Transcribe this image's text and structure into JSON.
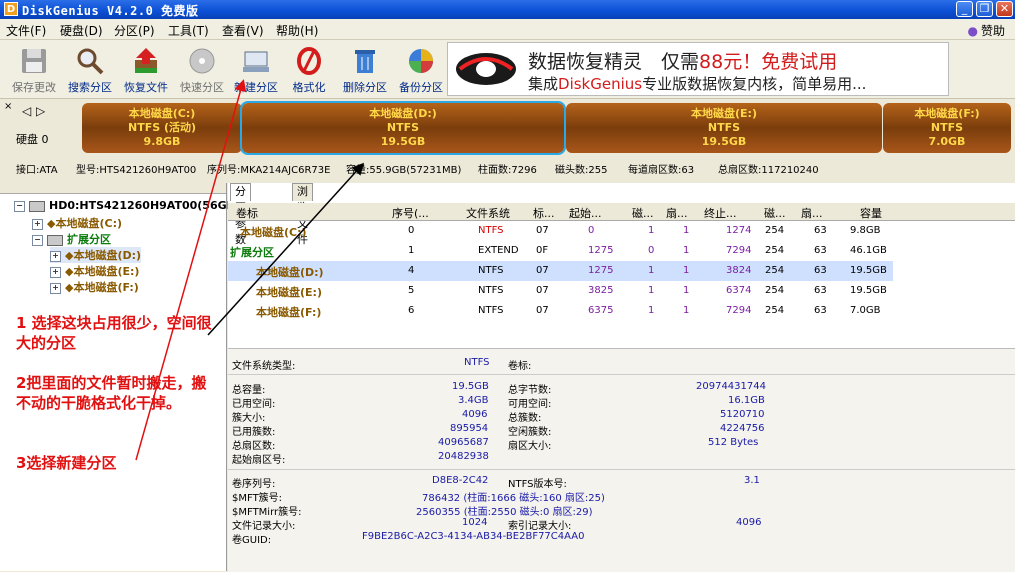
{
  "window": {
    "title": "DiskGenius V4.2.0 免费版",
    "app_icon": "D"
  },
  "menu": [
    "文件(F)",
    "硬盘(D)",
    "分区(P)",
    "工具(T)",
    "查看(V)",
    "帮助(H)"
  ],
  "sponsor": "赞助",
  "toolbar": [
    "保存更改",
    "搜索分区",
    "恢复文件",
    "快速分区",
    "新建分区",
    "格式化",
    "删除分区",
    "备份分区"
  ],
  "banner": {
    "line1_a": "数据恢复精灵",
    "line1_b": "仅需",
    "line1_price": "88元",
    "line1_c": "！免费试用",
    "line2_a": "集成",
    "line2_brand": "DiskGenius",
    "line2_b": "专业版数据恢复内核，简单易用..."
  },
  "disk": {
    "label": "硬盘 0",
    "partitions": [
      {
        "name": "本地磁盘(C:)",
        "fs": "NTFS (活动)",
        "size": "9.8GB"
      },
      {
        "name": "本地磁盘(D:)",
        "fs": "NTFS",
        "size": "19.5GB"
      },
      {
        "name": "本地磁盘(E:)",
        "fs": "NTFS",
        "size": "19.5GB"
      },
      {
        "name": "本地磁盘(F:)",
        "fs": "NTFS",
        "size": "7.0GB"
      }
    ],
    "info": {
      "interface": "接口:ATA",
      "model": "型号:HTS421260H9AT00",
      "serial": "序列号:MKA214AJC6R73E",
      "capacity": "容量:55.9GB(57231MB)",
      "cylinders": "柱面数:7296",
      "heads": "磁头数:255",
      "sectors_per_track": "每道扇区数:63",
      "total_sectors": "总扇区数:117210240"
    }
  },
  "tree": {
    "root": "HD0:HTS421260H9AT00(56GB)",
    "c": "本地磁盘(C:)",
    "ext": "扩展分区",
    "d": "本地磁盘(D:)",
    "e": "本地磁盘(E:)",
    "f": "本地磁盘(F:)"
  },
  "annotations": {
    "a1": "1 选择这块占用很少，空间很大的分区",
    "a2": "2把里面的文件暂时搬走，搬不动的干脆格式化干掉。",
    "a3": "3选择新建分区"
  },
  "tabs": [
    "分区参数",
    "浏览文件"
  ],
  "table": {
    "headers": [
      "卷标",
      "序号(...",
      "文件系统",
      "标...",
      "起始...",
      "磁...",
      "扇...",
      "终止...",
      "磁...",
      "扇...",
      "容量"
    ],
    "rows": [
      {
        "name": "本地磁盘(C:)",
        "idx": "0",
        "fs": "NTFS",
        "id": "07",
        "sc": "0",
        "sh": "1",
        "ss": "1",
        "ec": "1274",
        "eh": "254",
        "es": "63",
        "size": "9.8GB"
      },
      {
        "name": "扩展分区",
        "idx": "1",
        "fs": "EXTEND",
        "id": "0F",
        "sc": "1275",
        "sh": "0",
        "ss": "1",
        "ec": "7294",
        "eh": "254",
        "es": "63",
        "size": "46.1GB"
      },
      {
        "name": "本地磁盘(D:)",
        "idx": "4",
        "fs": "NTFS",
        "id": "07",
        "sc": "1275",
        "sh": "1",
        "ss": "1",
        "ec": "3824",
        "eh": "254",
        "es": "63",
        "size": "19.5GB"
      },
      {
        "name": "本地磁盘(E:)",
        "idx": "5",
        "fs": "NTFS",
        "id": "07",
        "sc": "3825",
        "sh": "1",
        "ss": "1",
        "ec": "6374",
        "eh": "254",
        "es": "63",
        "size": "19.5GB"
      },
      {
        "name": "本地磁盘(F:)",
        "idx": "6",
        "fs": "NTFS",
        "id": "07",
        "sc": "6375",
        "sh": "1",
        "ss": "1",
        "ec": "7294",
        "eh": "254",
        "es": "63",
        "size": "7.0GB"
      }
    ]
  },
  "details": {
    "fs_type_label": "文件系统类型:",
    "fs_type": "NTFS",
    "vol_label": "卷标:",
    "total_cap_l": "总容量:",
    "total_cap": "19.5GB",
    "total_bytes_l": "总字节数:",
    "total_bytes": "20974431744",
    "used_l": "已用空间:",
    "used": "3.4GB",
    "free_l": "可用空间:",
    "free": "16.1GB",
    "cluster_l": "簇大小:",
    "cluster": "4096",
    "clusters_l": "总簇数:",
    "clusters": "5120710",
    "used_cl_l": "已用簇数:",
    "used_cl": "895954",
    "free_cl_l": "空闲簇数:",
    "free_cl": "4224756",
    "sectors_l": "总扇区数:",
    "sectors": "40965687",
    "sector_size_l": "扇区大小:",
    "sector_size": "512 Bytes",
    "start_l": "起始扇区号:",
    "start": "20482938",
    "serial_l": "卷序列号:",
    "serial": "D8E8-2C42",
    "ntfs_ver_l": "NTFS版本号:",
    "ntfs_ver": "3.1",
    "mft_l": "$MFT簇号:",
    "mft": "786432 (柱面:1666 磁头:160 扇区:25)",
    "mftm_l": "$MFTMirr簇号:",
    "mftm": "2560355 (柱面:2550 磁头:0 扇区:29)",
    "rec_l": "文件记录大小:",
    "rec": "1024",
    "idx_l": "索引记录大小:",
    "idx": "4096",
    "guid_l": "卷GUID:",
    "guid": "F9BE2B6C-A2C3-4134-AB34-BE2BF77C4AA0"
  }
}
